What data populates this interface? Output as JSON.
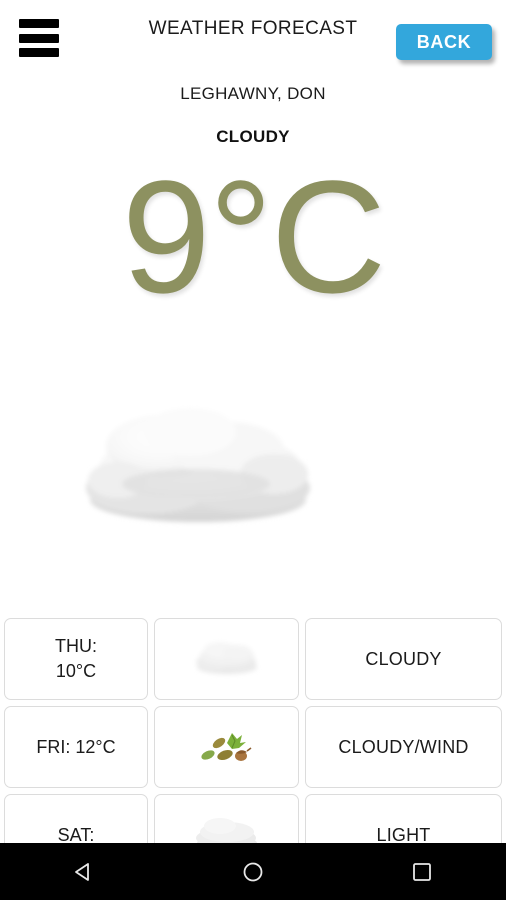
{
  "header": {
    "title": "WEATHER FORECAST",
    "back_label": "BACK",
    "menu_icon": "hamburger-menu-icon",
    "back_button_color": "#33a7dc"
  },
  "current": {
    "location": "LEGHAWNY, DON",
    "condition": "CLOUDY",
    "temperature": "9°C",
    "temperature_color": "#8d9160",
    "hero_icon": "cloud-icon"
  },
  "forecast": {
    "rows": [
      {
        "day": "THU:\n10°C",
        "icon": "cloud-icon",
        "description": "CLOUDY"
      },
      {
        "day": "FRI: 12°C",
        "icon": "leaves-acorns-wind-icon",
        "description": "CLOUDY/WIND"
      },
      {
        "day": "SAT:",
        "icon": "cloud-icon",
        "description": "LIGHT"
      }
    ]
  },
  "navbar": {
    "back_icon": "triangle-back-icon",
    "home_icon": "circle-home-icon",
    "recents_icon": "square-recents-icon"
  }
}
